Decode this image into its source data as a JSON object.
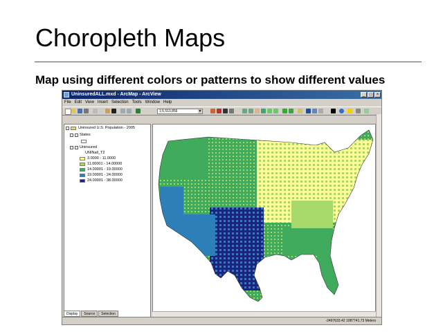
{
  "slide": {
    "title": "Choropleth Maps",
    "subtitle": "Map using different colors or patterns to show different values"
  },
  "window": {
    "title": "UninsuredALL.mxd - ArcMap - ArcView",
    "menu": [
      "File",
      "Edit",
      "View",
      "Insert",
      "Selection",
      "Tools",
      "Window",
      "Help"
    ],
    "scale": "1:5,513,856",
    "coordinates": "-2497633.42  1087741.73 Meters"
  },
  "toc": {
    "data_frame": "Uninsured U.S. Population - 2005",
    "layer_states": "States",
    "layer_uninsured": "Uninsured",
    "field": "UNINall_T2",
    "classes": [
      {
        "label": "3.0000 - 11.0000",
        "color": "#ffff99"
      },
      {
        "label": "11.00001 - 14.00000",
        "color": "#a6d96a"
      },
      {
        "label": "14.00001 - 19.00000",
        "color": "#41ab5d"
      },
      {
        "label": "19.00001 - 24.00000",
        "color": "#2c7fb8"
      },
      {
        "label": "24.00001 - 38.00000",
        "color": "#1a237e"
      }
    ],
    "tabs": [
      "Display",
      "Source",
      "Selection"
    ]
  },
  "colors": {
    "title_rule": "#a83232",
    "titlebar_start": "#0a246a",
    "titlebar_end": "#3a6ea5"
  }
}
